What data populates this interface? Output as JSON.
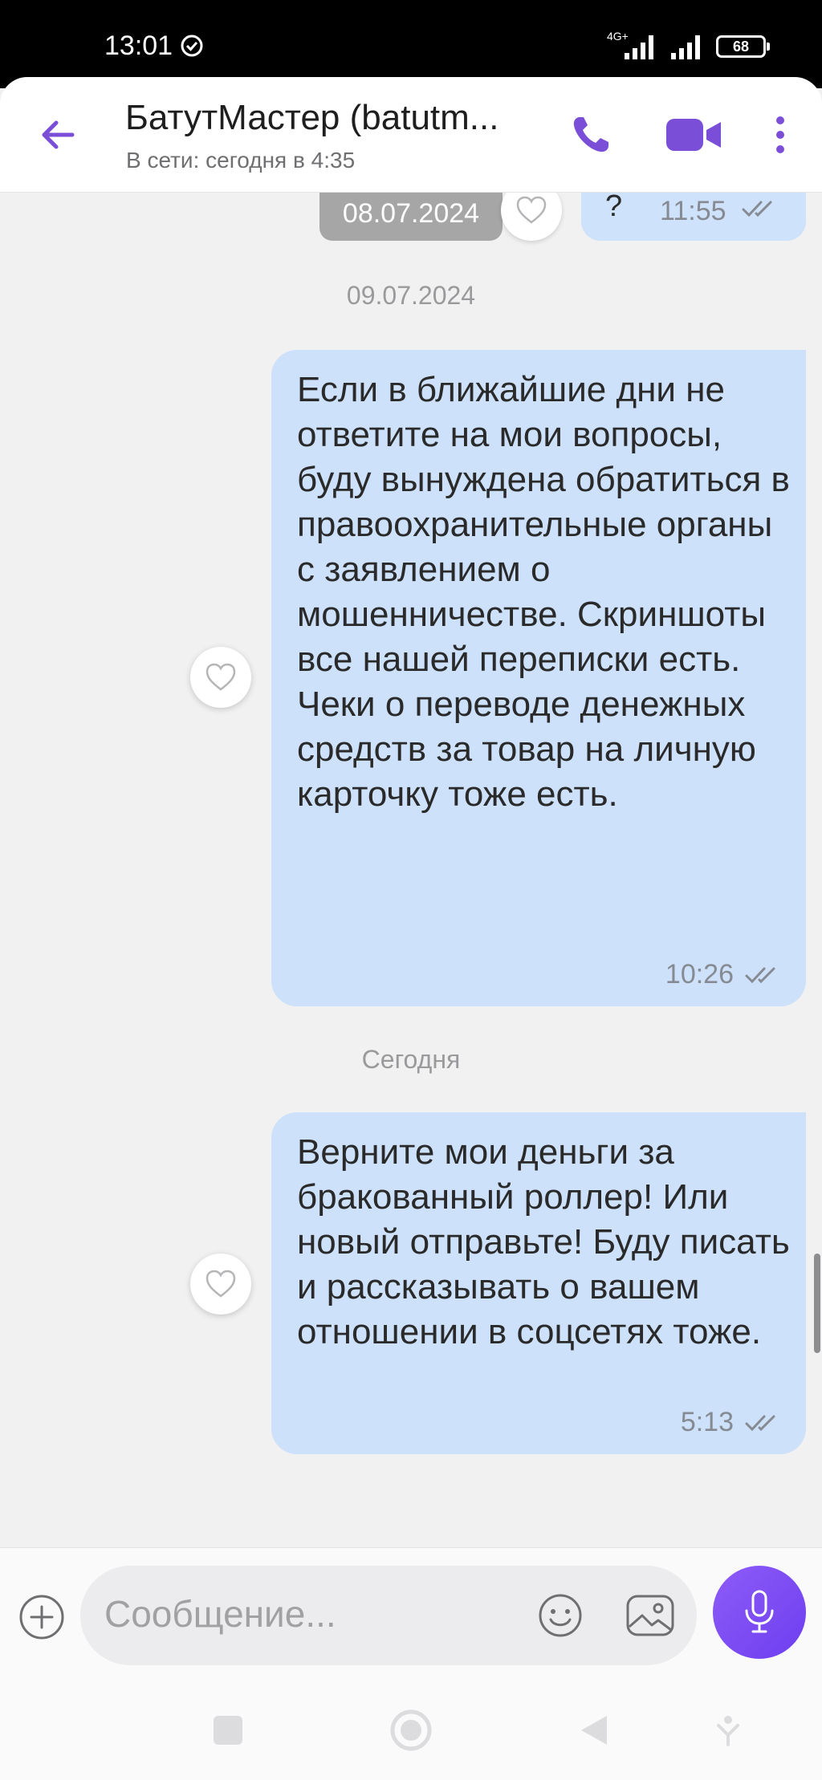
{
  "status_bar": {
    "time": "13:01",
    "network": "4G+",
    "battery": "68"
  },
  "header": {
    "contact_name": "БатутМастер (batutm...",
    "status": "В сети: сегодня в 4:35"
  },
  "chat": {
    "previous": {
      "date_badge": "08.07.2024",
      "text": "?",
      "time": "11:55"
    },
    "sections": [
      {
        "date": "09.07.2024",
        "message": {
          "text": "Если в ближайшие дни не ответите на мои вопросы, буду вынуждена обратиться в правоохранительные органы с заявлением о мошенничестве. Скриншоты все нашей переписки есть. Чеки о переводе денежных средств за товар на личную карточку тоже есть.",
          "time": "10:26"
        }
      },
      {
        "date": "Сегодня",
        "message": {
          "text": "Верните мои деньги за бракованный роллер! Или новый отправьте! Буду писать и рассказывать о вашем отношении в соцсетях тоже.",
          "time": "5:13"
        }
      }
    ]
  },
  "input": {
    "placeholder": "Сообщение..."
  },
  "colors": {
    "accent": "#7c4dff",
    "outgoing_bubble": "#cde1fb",
    "background": "#f1f1f2"
  },
  "icons": [
    "back-arrow-icon",
    "phone-icon",
    "video-camera-icon",
    "more-vert-icon",
    "heart-icon",
    "double-check-icon",
    "plus-icon",
    "emoji-icon",
    "gallery-icon",
    "microphone-icon"
  ]
}
